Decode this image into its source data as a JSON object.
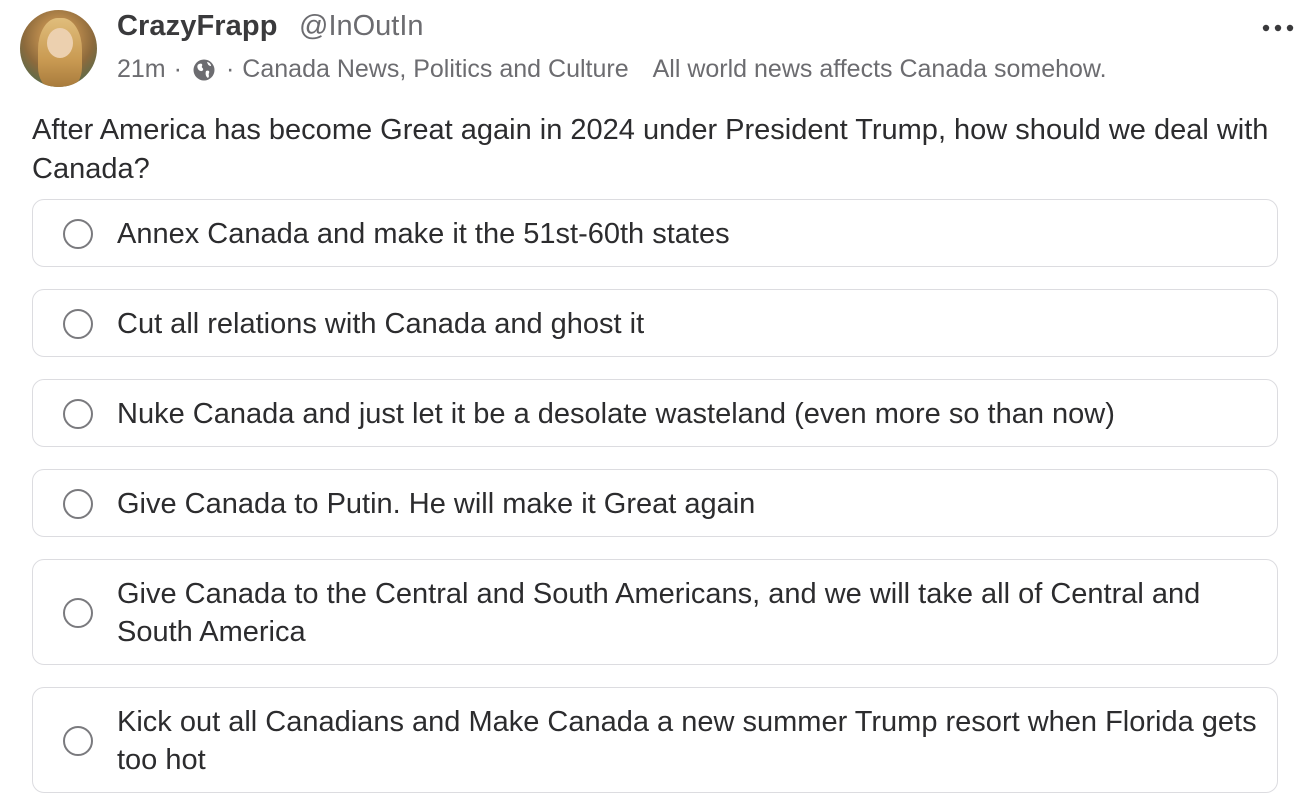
{
  "author": {
    "name": "CrazyFrapp",
    "handle": "@InOutIn"
  },
  "meta": {
    "time": "21m",
    "dot1": "·",
    "dot2": "·",
    "community": "Canada News, Politics and Culture",
    "community_description": "All world news affects Canada somehow."
  },
  "icons": {
    "visibility": "globe-icon",
    "more": "more-horizontal-icon"
  },
  "colors": {
    "text": "#2c2c2e",
    "muted": "#6c6c70",
    "border": "#dcdce0"
  },
  "poll": {
    "question": "After America has become Great again in 2024 under President Trump, how should we deal with Canada?",
    "options": [
      {
        "label": "Annex Canada and make it the 51st-60th states"
      },
      {
        "label": "Cut all relations with Canada and ghost it"
      },
      {
        "label": "Nuke Canada and just let it be a desolate wasteland (even more so than now)"
      },
      {
        "label": "Give Canada to Putin.  He will make it Great again"
      },
      {
        "label": "Give Canada to the Central and South Americans, and we will take all of Central and South America"
      },
      {
        "label": "Kick out all Canadians and Make Canada a new summer Trump resort when Florida gets too hot"
      }
    ]
  }
}
